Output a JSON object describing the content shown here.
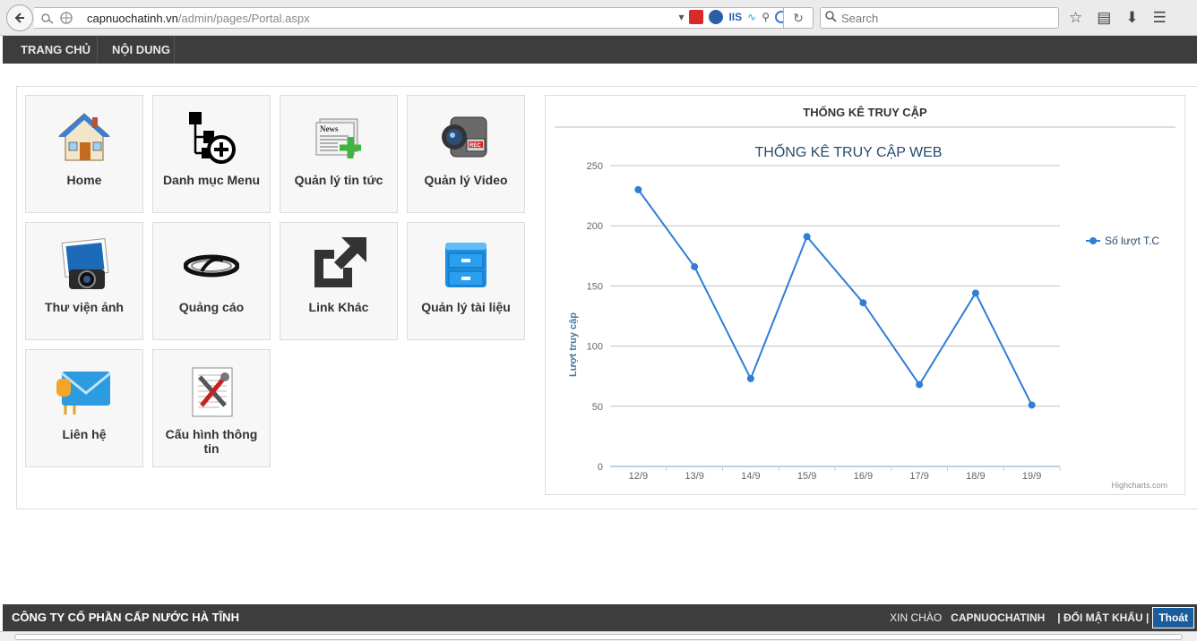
{
  "browser": {
    "url_host": "capnuochatinh.vn",
    "url_path": "/admin/pages/Portal.aspx",
    "search_placeholder": "Search"
  },
  "nav": {
    "items": [
      {
        "label": "TRANG CHỦ"
      },
      {
        "label": "NỘI DUNG"
      }
    ]
  },
  "tiles": [
    {
      "label": "Home",
      "icon": "home-icon"
    },
    {
      "label": "Danh mục Menu",
      "icon": "menu-tree-icon"
    },
    {
      "label": "Quản lý tin tức",
      "icon": "news-icon"
    },
    {
      "label": "Quản lý Video",
      "icon": "video-camera-icon"
    },
    {
      "label": "Thư viện ảnh",
      "icon": "photo-icon"
    },
    {
      "label": "Quảng cáo",
      "icon": "ad-icon"
    },
    {
      "label": "Link Khác",
      "icon": "external-link-icon"
    },
    {
      "label": "Quản lý tài liệu",
      "icon": "file-cabinet-icon"
    },
    {
      "label": "Liên hệ",
      "icon": "envelope-icon"
    },
    {
      "label": "Cấu hình thông tin",
      "icon": "settings-tools-icon"
    }
  ],
  "chart_panel": {
    "header": "THỐNG KÊ TRUY CẬP"
  },
  "chart_data": {
    "type": "line",
    "title": "THỐNG KÊ TRUY CẬP WEB",
    "xlabel": "",
    "ylabel": "Lượt truy cập",
    "categories": [
      "12/9",
      "13/9",
      "14/9",
      "15/9",
      "16/9",
      "17/9",
      "18/9",
      "19/9"
    ],
    "series": [
      {
        "name": "Số lượt T.C",
        "values": [
          230,
          166,
          73,
          191,
          136,
          68,
          144,
          51
        ],
        "color": "#2f7ed8"
      }
    ],
    "ylim": [
      0,
      250
    ],
    "yticks": [
      0,
      50,
      100,
      150,
      200,
      250
    ],
    "grid": true,
    "legend": "right",
    "credit": "Highcharts.com"
  },
  "footer": {
    "company": "CÔNG TY CỔ PHẦN CẤP NƯỚC HÀ TĨNH",
    "greeting": "XIN CHÀO",
    "username": "CAPNUOCHATINH",
    "change_password": "| ĐỔI MẬT KHẨU |",
    "logout": "Thoát"
  },
  "colors": {
    "nav_bg": "#3d3d3d",
    "series": "#2f7ed8",
    "logout_bg": "#1a5d9c"
  }
}
